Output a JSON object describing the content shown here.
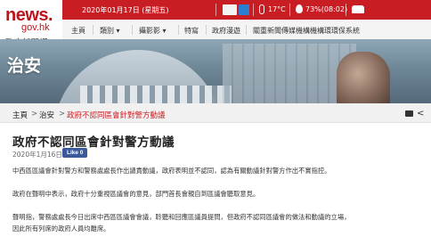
{
  "logo": {
    "news": "news.",
    "gov": "gov.hk",
    "cn": "政府新聞網"
  },
  "topbar": {
    "date": "2020年01月17日 (星期五)",
    "temperature": "17°C",
    "humidity": "73%(08:02)",
    "color": "#c91d24"
  },
  "nav": {
    "items": [
      "主頁",
      "類別",
      "攝影影",
      "特寫",
      "政府漫遊",
      "關重新聞傳媒機構機構環環保系統"
    ]
  },
  "banner": {
    "title": "治安"
  },
  "breadcrumb": {
    "items": [
      "主頁",
      "治安",
      "政府不認同區會針對警方動議"
    ]
  },
  "article": {
    "title": "政府不認同區會針對警方動議",
    "date": "2020年1月16日",
    "like_label": "Like 0",
    "paragraphs": [
      "中西區區議會針對警方和警務處處長作出譴責動議，政府表明並不認同，認為有關動議針對警方作出不實指控。",
      "政府在聲明中表示，政府十分重視區議會的意見，部門首長會親自到區議會聽取意見。",
      "聲明指，警務處處長今日出席中西區區議會會議，聆聽和回應區議員提問，但政府不認同區議會的做法和動議的立場，",
      "因此所有列席的政府人員均離席。"
    ]
  }
}
